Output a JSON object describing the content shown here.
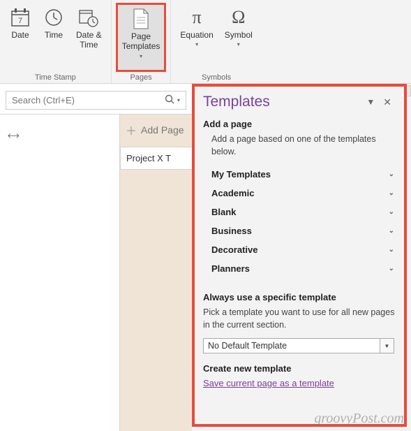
{
  "ribbon": {
    "groups": [
      {
        "label": "Time Stamp",
        "items": [
          {
            "name": "date-button",
            "label": "Date",
            "icon": "calendar-7"
          },
          {
            "name": "time-button",
            "label": "Time",
            "icon": "clock"
          },
          {
            "name": "datetime-button",
            "label": "Date &\nTime",
            "icon": "calendar-clock"
          }
        ]
      },
      {
        "label": "Pages",
        "items": [
          {
            "name": "page-templates-button",
            "label": "Page\nTemplates",
            "icon": "page",
            "dropdown": true,
            "highlighted": true
          }
        ]
      },
      {
        "label": "Symbols",
        "items": [
          {
            "name": "equation-button",
            "label": "Equation",
            "icon": "pi",
            "dropdown": true
          },
          {
            "name": "symbol-button",
            "label": "Symbol",
            "icon": "omega",
            "dropdown": true
          }
        ]
      }
    ]
  },
  "search": {
    "placeholder": "Search (Ctrl+E)"
  },
  "pages": {
    "add_label": "Add Page",
    "tabs": [
      "Project X T"
    ]
  },
  "templates": {
    "title": "Templates",
    "add_head": "Add a page",
    "add_desc": "Add a page based on one of the templates below.",
    "categories": [
      "My Templates",
      "Academic",
      "Blank",
      "Business",
      "Decorative",
      "Planners"
    ],
    "always_head": "Always use a specific template",
    "always_desc": "Pick a template you want to use for all new pages in the current section.",
    "default_select": "No Default Template",
    "create_head": "Create new template",
    "save_link": "Save current page as a template"
  },
  "watermark": "groovyPost.com"
}
